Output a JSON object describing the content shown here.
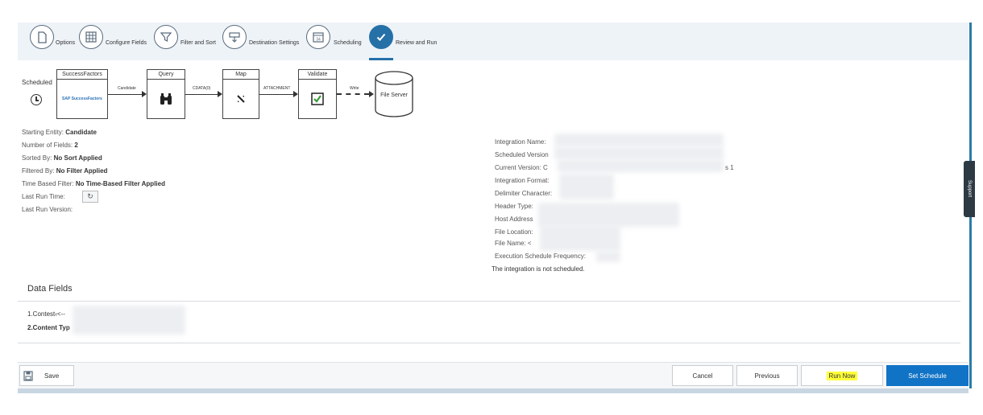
{
  "wizard": {
    "steps": [
      {
        "label": "Options",
        "icon": "document-icon"
      },
      {
        "label": "Configure Fields",
        "icon": "grid-icon"
      },
      {
        "label": "Filter and Sort",
        "icon": "filter-icon"
      },
      {
        "label": "Destination Settings",
        "icon": "destination-icon"
      },
      {
        "label": "Scheduling",
        "icon": "calendar-icon",
        "icon_text": "34"
      },
      {
        "label": "Review and Run",
        "icon": "checkmark-icon",
        "active": true
      }
    ]
  },
  "flow": {
    "scheduled_label": "Scheduled",
    "boxes": [
      {
        "title": "SuccessFactors",
        "logo": "SAP SuccessFactors"
      },
      {
        "title": "Query"
      },
      {
        "title": "Map"
      },
      {
        "title": "Validate"
      }
    ],
    "connectors": [
      "Candidate",
      "CDATA(0)",
      "ATTACHMENT",
      "Write"
    ],
    "destination": "File Server"
  },
  "details_left": [
    {
      "label": "Starting Entity:",
      "value": "Candidate"
    },
    {
      "label": "Number of Fields:",
      "value": "2"
    },
    {
      "label": "Sorted By:",
      "value": "No Sort Applied"
    },
    {
      "label": "Filtered By:",
      "value": "No Filter Applied"
    },
    {
      "label": "Time Based Filter:",
      "value": "No Time-Based Filter Applied"
    },
    {
      "label": "Last Run Time:",
      "value": ""
    },
    {
      "label": "Last Run Version:",
      "value": ""
    }
  ],
  "details_right": [
    {
      "label": "Integration Name:"
    },
    {
      "label": "Scheduled Version"
    },
    {
      "label": "Current Version:",
      "value": "C",
      "suffix": "s 1"
    },
    {
      "label": "Integration Format:"
    },
    {
      "label": "Delimiter Character:"
    },
    {
      "label": "Header Type:"
    },
    {
      "label": "Host Address"
    },
    {
      "label": "File Location:"
    },
    {
      "label": "File Name:",
      "value": "<"
    },
    {
      "label": "Execution Schedule Frequency:"
    }
  ],
  "not_scheduled": "The integration is not scheduled.",
  "data_fields": {
    "title": "Data Fields",
    "items": [
      "1.Contest‹<--",
      "2.Content Typ"
    ]
  },
  "support_tab": "Support",
  "footer": {
    "save": "Save",
    "cancel": "Cancel",
    "previous": "Previous",
    "run_now": "Run Now",
    "set_schedule": "Set Schedule"
  },
  "colors": {
    "accent": "#2670a8",
    "primary_button": "#1173c5",
    "highlight": "#ffff3a"
  }
}
